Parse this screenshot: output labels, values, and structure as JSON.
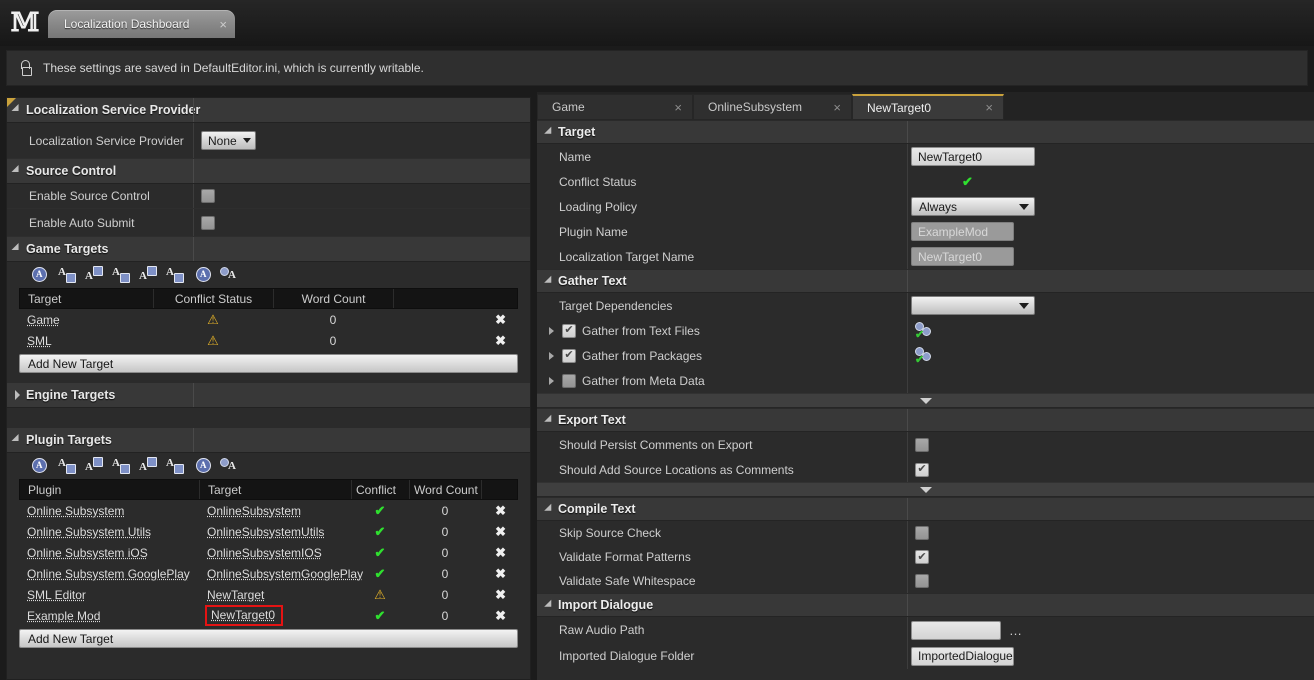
{
  "window": {
    "logo": "unreal-logo",
    "tab_title": "Localization Dashboard",
    "tab_close": "×"
  },
  "notice": {
    "icon": "unlocked-padlock-icon",
    "text": "These settings are saved in DefaultEditor.ini, which is currently writable."
  },
  "left_panel": {
    "service_provider": {
      "title": "Localization Service Provider",
      "row_label": "Localization Service Provider",
      "value": "None"
    },
    "source_control": {
      "title": "Source Control",
      "rows": [
        {
          "label": "Enable Source Control",
          "checked": false
        },
        {
          "label": "Enable Auto Submit",
          "checked": false
        }
      ]
    },
    "game_targets": {
      "title": "Game Targets",
      "columns": [
        "Target",
        "Conflict Status",
        "Word Count",
        ""
      ],
      "rows": [
        {
          "target": "Game",
          "conflict": "warning",
          "words": "0",
          "remove": "✖"
        },
        {
          "target": "SML",
          "conflict": "warning",
          "words": "0",
          "remove": "✖"
        }
      ],
      "add_button": "Add New Target"
    },
    "engine_targets": {
      "title": "Engine Targets",
      "collapsed": true
    },
    "plugin_targets": {
      "title": "Plugin Targets",
      "columns": [
        "Plugin",
        "Target",
        "Conflict",
        "Word Count",
        ""
      ],
      "rows": [
        {
          "plugin": "Online Subsystem",
          "target": "OnlineSubsystem",
          "conflict": "ok",
          "words": "0",
          "remove": "✖",
          "highlight": false
        },
        {
          "plugin": "Online Subsystem Utils",
          "target": "OnlineSubsystemUtils",
          "conflict": "ok",
          "words": "0",
          "remove": "✖",
          "highlight": false
        },
        {
          "plugin": "Online Subsystem iOS",
          "target": "OnlineSubsystemIOS",
          "conflict": "ok",
          "words": "0",
          "remove": "✖",
          "highlight": false
        },
        {
          "plugin": "Online Subsystem GooglePlay",
          "target": "OnlineSubsystemGooglePlay",
          "conflict": "ok",
          "words": "0",
          "remove": "✖",
          "highlight": false
        },
        {
          "plugin": "SML Editor",
          "target": "NewTarget",
          "conflict": "warning",
          "words": "0",
          "remove": "✖",
          "highlight": false
        },
        {
          "plugin": "Example Mod",
          "target": "NewTarget0",
          "conflict": "ok",
          "words": "0",
          "remove": "✖",
          "highlight": true
        }
      ],
      "add_button": "Add New Target"
    },
    "toolbar_icons": [
      "compile-all-targets-icon",
      "gather-text-icon",
      "import-text-icon",
      "export-text-icon",
      "import-dialogue-script-icon",
      "export-dialogue-script-icon",
      "count-words-icon",
      "compile-text-icon"
    ]
  },
  "right_panel": {
    "tabs": [
      {
        "label": "Game",
        "close": "×",
        "active": false
      },
      {
        "label": "OnlineSubsystem",
        "close": "×",
        "active": false
      },
      {
        "label": "NewTarget0",
        "close": "×",
        "active": true
      }
    ],
    "target_section": {
      "title": "Target",
      "name_label": "Name",
      "name_value": "NewTarget0",
      "conflict_label": "Conflict Status",
      "conflict_status": "ok",
      "loading_policy_label": "Loading Policy",
      "loading_policy_value": "Always",
      "plugin_name_label": "Plugin Name",
      "plugin_name_value": "ExampleMod",
      "loc_target_name_label": "Localization Target Name",
      "loc_target_name_value": "NewTarget0"
    },
    "gather_text": {
      "title": "Gather Text",
      "dependencies_label": "Target Dependencies",
      "dependencies_value": "",
      "rows": [
        {
          "label": "Gather from Text Files",
          "checked": true,
          "has_gear": true
        },
        {
          "label": "Gather from Packages",
          "checked": true,
          "has_gear": true
        },
        {
          "label": "Gather from Meta Data",
          "checked": false,
          "has_gear": false
        }
      ]
    },
    "export_text": {
      "title": "Export Text",
      "rows": [
        {
          "label": "Should Persist Comments on Export",
          "checked": false
        },
        {
          "label": "Should Add Source Locations as Comments",
          "checked": true
        }
      ]
    },
    "compile_text": {
      "title": "Compile Text",
      "rows": [
        {
          "label": "Skip Source Check",
          "checked": false
        },
        {
          "label": "Validate Format Patterns",
          "checked": true
        },
        {
          "label": "Validate Safe Whitespace",
          "checked": false
        }
      ]
    },
    "import_dialogue": {
      "title": "Import Dialogue",
      "raw_audio_label": "Raw Audio Path",
      "raw_audio_value": "",
      "browse_button": "…",
      "imported_folder_label": "Imported Dialogue Folder",
      "imported_folder_value": "ImportedDialogue"
    }
  },
  "colors": {
    "accent": "#caa23c",
    "ok": "#2fe02f",
    "warning": "#e4b228",
    "highlight": "#e51313",
    "panel_bg": "#2b2b2b",
    "header_bg": "#383838"
  }
}
